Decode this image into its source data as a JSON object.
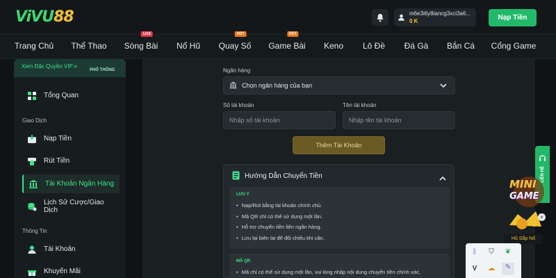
{
  "header": {
    "logo": {
      "part1": "ViVU",
      "part2": "88"
    },
    "user": {
      "name": "m6e3i6y8iancg3xci3a6...",
      "balance": "0 K"
    },
    "deposit_button": "Nạp Tiền"
  },
  "nav": {
    "items": [
      {
        "label": "Trang Chủ",
        "badge": ""
      },
      {
        "label": "Thể Thao",
        "badge": ""
      },
      {
        "label": "Sòng Bài",
        "badge": "LIVE"
      },
      {
        "label": "Nổ Hũ",
        "badge": ""
      },
      {
        "label": "Quay Số",
        "badge": "HOT"
      },
      {
        "label": "Game Bài",
        "badge": "HOT"
      },
      {
        "label": "Keno",
        "badge": ""
      },
      {
        "label": "Lô Đề",
        "badge": ""
      },
      {
        "label": "Đá Gà",
        "badge": ""
      },
      {
        "label": "Bắn Cá",
        "badge": ""
      },
      {
        "label": "Cổng Game",
        "badge": ""
      }
    ]
  },
  "sidebar": {
    "vip_text": "Xem Đặc Quyền VIP",
    "vip_tier": "PHỔ THÔNG",
    "overview": "Tổng Quan",
    "sections": {
      "transactions": "Giao Dịch",
      "info": "Thông Tin"
    },
    "transactions": [
      {
        "label": "Nạp Tiền",
        "active": false
      },
      {
        "label": "Rút Tiền",
        "active": false
      },
      {
        "label": "Tài Khoản Ngân Hàng",
        "active": true
      },
      {
        "label": "Lịch Sử Cược/Giao Dịch",
        "active": false
      }
    ],
    "info": [
      {
        "label": "Tài Khoản"
      },
      {
        "label": "Khuyến Mãi"
      }
    ]
  },
  "form": {
    "bank_label": "Ngân hàng",
    "bank_select": "Chọn ngân hàng của bạn",
    "account_number_label": "Số tài khoản",
    "account_number_placeholder": "Nhập số tài khoản",
    "account_name_label": "Tên tài khoản",
    "account_name_placeholder": "Nhập tên tài khoản",
    "add_button": "Thêm Tài Khoản"
  },
  "guide": {
    "title": "Hướng Dẫn Chuyển Tiền",
    "note_title": "LƯU Ý",
    "notes": [
      "Nạp/Rút bằng tài khoản chính chủ.",
      "Mã QR chỉ có thể sử dụng một lần.",
      "Hỗ trợ chuyển tiền liên ngân hàng.",
      "Lưu lại biên lai để đối chiếu khi cần."
    ],
    "qr_title": "MÃ QR",
    "qr_notes": [
      "Mã chỉ có thể sử dụng một lần, vui lòng nhập nội dung chuyển tiền chính xác,"
    ]
  },
  "floating": {
    "contact": "LIÊN HỆ",
    "promo_line1": "MINI",
    "promo_line2": "GAME",
    "promo_jackpot": "Hũ Sắp Nổ"
  },
  "colors": {
    "accent": "#23b96a",
    "gold": "#f2c230",
    "background": "#0f1316",
    "live": "#e53a4e",
    "hot": "#e8791e"
  }
}
